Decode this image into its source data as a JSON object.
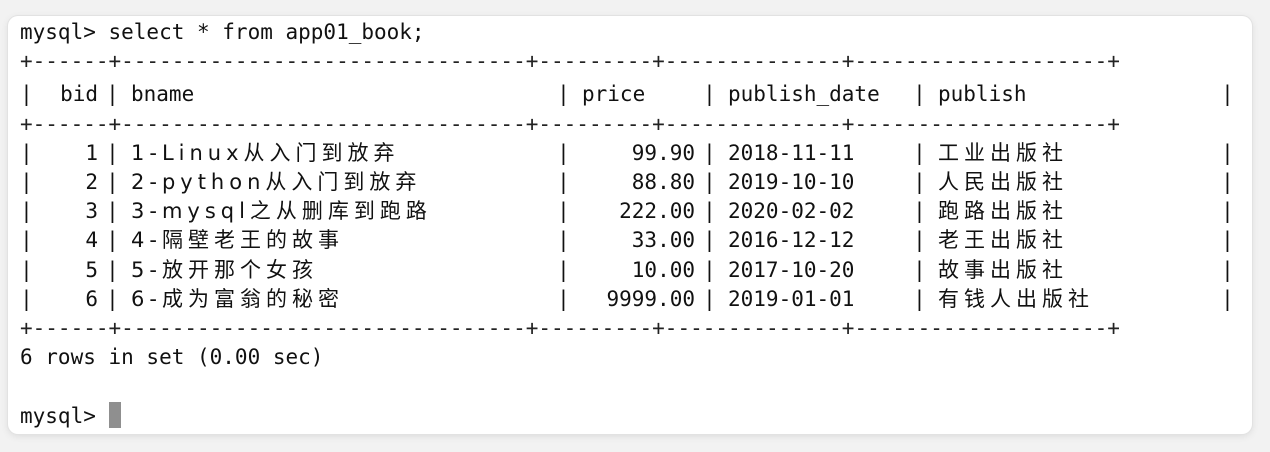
{
  "terminal": {
    "command_line": "mysql> select * from app01_book;",
    "separator": "+------+--------------------------------+---------+--------------+--------------------+",
    "columns": [
      "bid",
      "bname",
      "price",
      "publish_date",
      "publish"
    ],
    "rows": [
      {
        "bid": "1",
        "bname": "1-Linux从入门到放弃",
        "price": "99.90",
        "publish_date": "2018-11-11",
        "publish": "工业出版社"
      },
      {
        "bid": "2",
        "bname": "2-python从入门到放弃",
        "price": "88.80",
        "publish_date": "2019-10-10",
        "publish": "人民出版社"
      },
      {
        "bid": "3",
        "bname": "3-mysql之从删库到跑路",
        "price": "222.00",
        "publish_date": "2020-02-02",
        "publish": "跑路出版社"
      },
      {
        "bid": "4",
        "bname": "4-隔壁老王的故事",
        "price": "33.00",
        "publish_date": "2016-12-12",
        "publish": "老王出版社"
      },
      {
        "bid": "5",
        "bname": "5-放开那个女孩",
        "price": "10.00",
        "publish_date": "2017-10-20",
        "publish": "故事出版社"
      },
      {
        "bid": "6",
        "bname": "6-成为富翁的秘密",
        "price": "9999.00",
        "publish_date": "2019-01-01",
        "publish": "有钱人出版社"
      }
    ],
    "result_summary": "6 rows in set (0.00 sec)",
    "prompt": "mysql> "
  },
  "colors": {
    "text": "#111111",
    "background": "#ffffff",
    "cursor": "#8f8f8f"
  }
}
